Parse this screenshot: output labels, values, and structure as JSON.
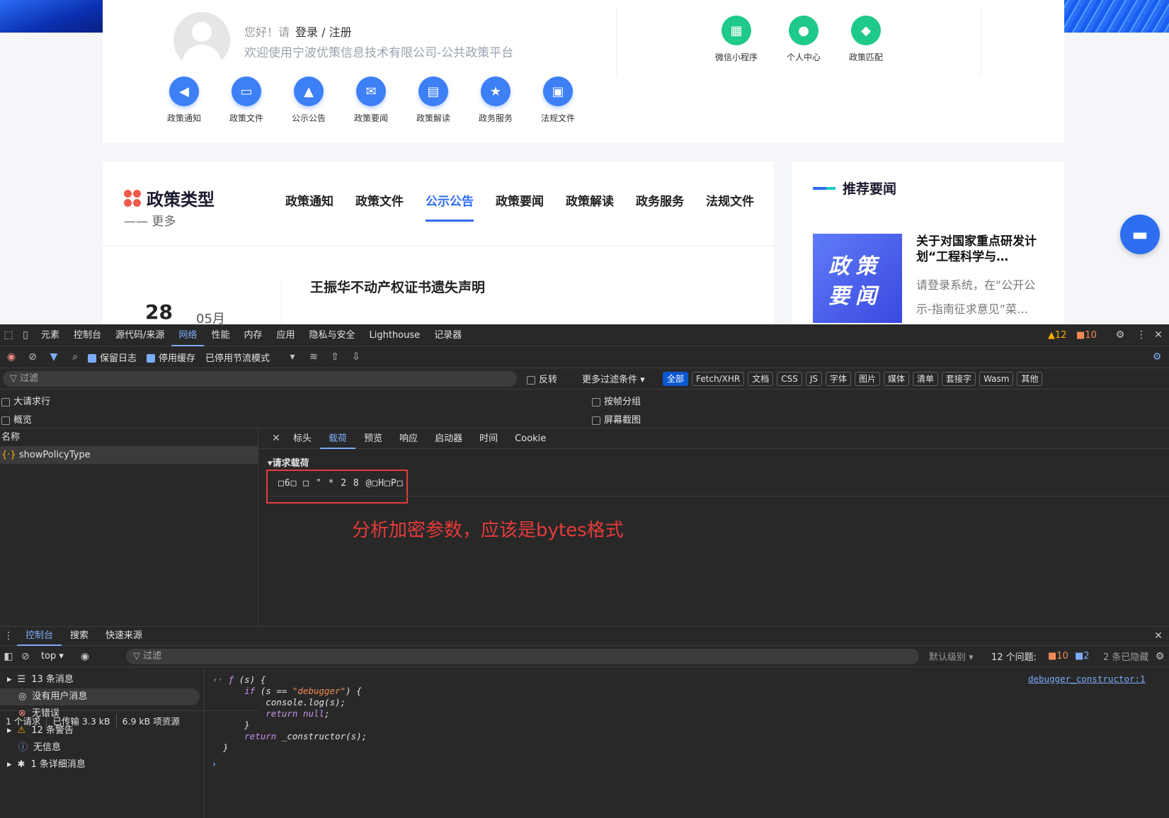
{
  "site": {
    "greeting": "您好！请",
    "login_label": "登录 / 注册",
    "welcome": "欢迎使用宁波优策信息技术有限公司-公共政策平台",
    "quick_links": [
      "政策通知",
      "政策文件",
      "公示公告",
      "政策要闻",
      "政策解读",
      "政务服务",
      "法规文件"
    ],
    "green_links": [
      "微信小程序",
      "个人中心",
      "政策匹配"
    ],
    "policy_type_title": "政策类型",
    "more_label": "—— 更多",
    "policy_tabs": [
      "政策通知",
      "政策文件",
      "公示公告",
      "政策要闻",
      "政策解读",
      "政务服务",
      "法规文件"
    ],
    "active_tab": "公示公告",
    "date_day": "28",
    "date_month": "05月",
    "news_title": "王振华不动产权证书遗失声明",
    "recommend_title": "推荐要闻",
    "rec_image_text": "政策要闻",
    "rec_headline": "关于对国家重点研发计划“工程科学与…",
    "rec_summary": "请登录系统，在“公开公示-指南征求意见”菜…"
  },
  "devtools": {
    "main_tabs": [
      "元素",
      "控制台",
      "源代码/来源",
      "网络",
      "性能",
      "内存",
      "应用",
      "隐私与安全",
      "Lighthouse",
      "记录器"
    ],
    "active_main_tab": "网络",
    "warnings_count": "12",
    "errors_count": "10",
    "preserve_log": "保留日志",
    "disable_cache": "停用缓存",
    "throttle": "已停用节流模式",
    "filter_placeholder": "过滤",
    "invert": "反转",
    "more_filters": "更多过滤条件",
    "type_chips": [
      "全部",
      "Fetch/XHR",
      "文档",
      "CSS",
      "JS",
      "字体",
      "图片",
      "媒体",
      "清单",
      "套接字",
      "Wasm",
      "其他"
    ],
    "big_request_rows": "大请求行",
    "overview": "概览",
    "group_by_frame": "按帧分组",
    "screenshots": "屏幕截图",
    "name_header": "名称",
    "request_name": "showPolicyType",
    "status": [
      "1 个请求",
      "已传输 3.3 kB",
      "6.9 kB 项资源"
    ],
    "detail_tabs": [
      "标头",
      "载荷",
      "预览",
      "响应",
      "启动器",
      "时间",
      "Cookie"
    ],
    "active_detail_tab": "载荷",
    "payload_header": "▾请求载荷",
    "payload_value": "□6□ □ \" * 2 8 @□H□P□",
    "annotation": "分析加密参数，应该是bytes格式",
    "drawer_tabs": [
      "控制台",
      "搜索",
      "快速来源"
    ],
    "active_drawer_tab": "控制台",
    "context": "top ▾",
    "console_filter": "过滤",
    "default_levels": "默认级别 ▾",
    "issues": "12 个问题:",
    "issues_err": "10",
    "issues_info": "2",
    "hidden": "2 条已隐藏",
    "sidebar_items": [
      "13 条消息",
      "没有用户消息",
      "无错误",
      "12 条警告",
      "无信息",
      "1 条详细消息"
    ],
    "source_link": "debugger_constructor:1"
  }
}
